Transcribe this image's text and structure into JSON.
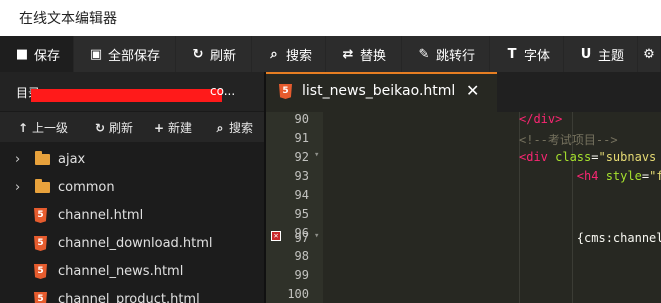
{
  "window": {
    "title": "在线文本编辑器"
  },
  "toolbar": {
    "buttons": [
      {
        "icon": "save-icon",
        "label": "保存"
      },
      {
        "icon": "save-all-icon",
        "label": "全部保存"
      },
      {
        "icon": "refresh-icon",
        "label": "刷新"
      },
      {
        "icon": "search-icon",
        "label": "搜索"
      },
      {
        "icon": "replace-icon",
        "label": "替换"
      },
      {
        "icon": "goto-line-icon",
        "label": "跳转行"
      },
      {
        "icon": "font-icon",
        "label": "字体"
      },
      {
        "icon": "theme-icon",
        "label": "主题"
      },
      {
        "icon": "settings-icon",
        "label": ""
      }
    ]
  },
  "sidebar": {
    "path_label": "目录：",
    "path_value_tail": "co...",
    "actions": [
      {
        "icon": "arrow-up-icon",
        "label": "上一级"
      },
      {
        "icon": "refresh-icon",
        "label": "刷新"
      },
      {
        "icon": "plus-icon",
        "label": "新建"
      },
      {
        "icon": "search-icon",
        "label": "搜索"
      }
    ],
    "tree": [
      {
        "type": "folder",
        "label": "ajax"
      },
      {
        "type": "folder",
        "label": "common"
      },
      {
        "type": "file",
        "label": "channel.html"
      },
      {
        "type": "file",
        "label": "channel_download.html"
      },
      {
        "type": "file",
        "label": "channel_news.html"
      },
      {
        "type": "file",
        "label": "channel_product.html"
      }
    ]
  },
  "tabs": [
    {
      "label": "list_news_beikao.html",
      "icon": "html5-icon",
      "active": true
    }
  ],
  "editor": {
    "lines": [
      {
        "n": "90",
        "code": "</div>"
      },
      {
        "n": "91",
        "code": "<!--考试项目-->"
      },
      {
        "n": "92",
        "code": "<div class=\"subnavs"
      },
      {
        "n": "93",
        "code": "    <h4 style=\"f"
      },
      {
        "n": "94",
        "code": ""
      },
      {
        "n": "95",
        "code": ""
      },
      {
        "n": "96",
        "code": ""
      },
      {
        "n": "97",
        "code": "        {cms:channel"
      },
      {
        "n": "98",
        "code": ""
      },
      {
        "n": "99",
        "code": ""
      },
      {
        "n": "100",
        "code": ""
      }
    ]
  },
  "colors": {
    "accent": "#e67e22",
    "editor_bg": "#272822",
    "tag": "#f92672",
    "attr": "#a6e22e",
    "string": "#e6db74",
    "comment": "#75715e",
    "error": "#c8282a"
  }
}
